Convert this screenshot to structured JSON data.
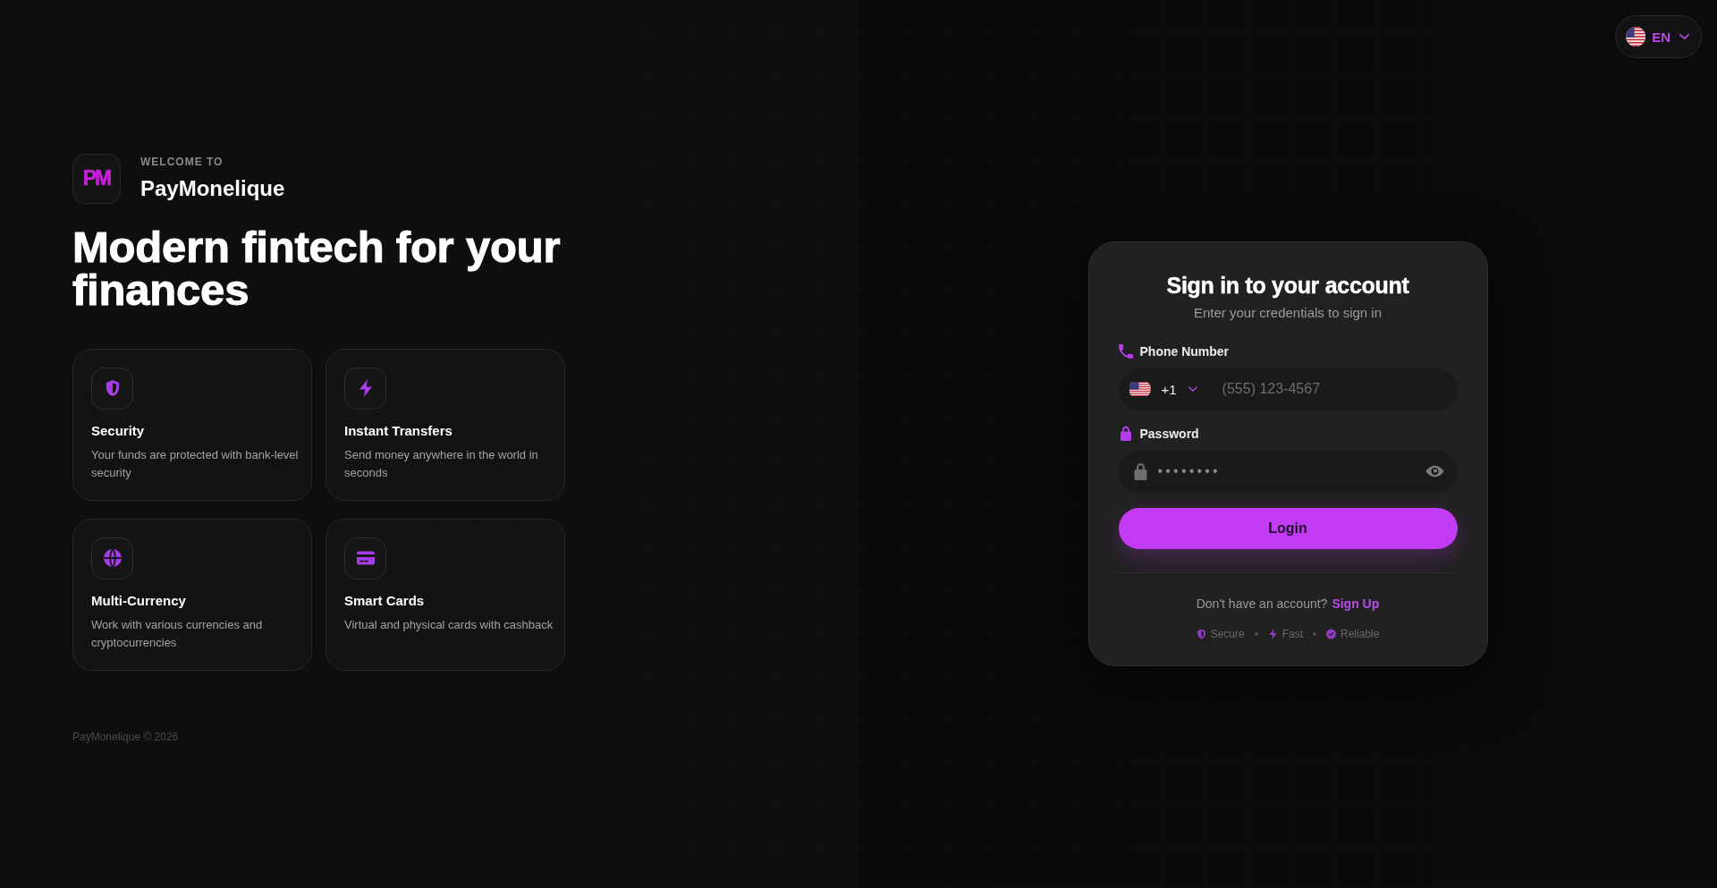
{
  "language_selector": {
    "label": "EN"
  },
  "brand": {
    "logo_text": "PM",
    "eyebrow": "WELCOME TO",
    "name": "PayMonelique"
  },
  "headline": "Modern fintech for your finances",
  "features": [
    {
      "title": "Security",
      "description": "Your funds are protected with bank-level security"
    },
    {
      "title": "Instant Transfers",
      "description": "Send money anywhere in the world in seconds"
    },
    {
      "title": "Multi-Currency",
      "description": "Work with various currencies and cryptocurrencies"
    },
    {
      "title": "Smart Cards",
      "description": "Virtual and physical cards with cashback"
    }
  ],
  "footer": "PayMonelique © 2026",
  "login_form": {
    "title": "Sign in to your account",
    "subtitle": "Enter your credentials to sign in",
    "phone": {
      "label": "Phone Number",
      "country_code": "+1",
      "placeholder": "(555) 123-4567"
    },
    "password": {
      "label": "Password",
      "placeholder": "••••••••"
    },
    "submit": "Login",
    "signup_prompt": "Don't have an account?",
    "signup_link": "Sign Up",
    "badges": [
      {
        "label": "Secure"
      },
      {
        "label": "Fast"
      },
      {
        "label": "Reliable"
      }
    ]
  }
}
